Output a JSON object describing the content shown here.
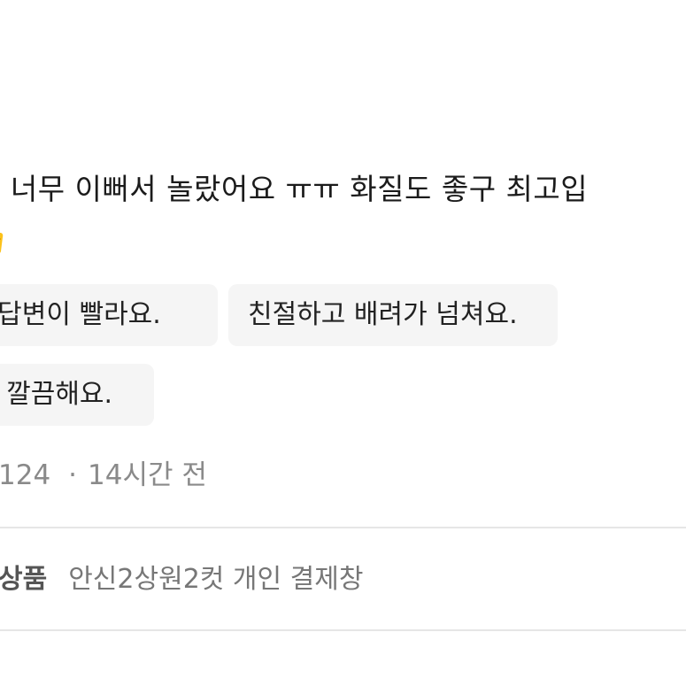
{
  "review": {
    "line1": "짜 너무 이뻐서 놀랐어요 ㅠㅠ 화질도 좋구 최고입",
    "line2_emoji": "thumbs-up-emoji"
  },
  "tags": [
    {
      "label": "톡 답변이 빨라요."
    },
    {
      "label": "친절하고 배려가 넘쳐요."
    },
    {
      "label": "이 깔끔해요."
    }
  ],
  "meta": {
    "count": "124",
    "separator": "·",
    "time": "14시간 전"
  },
  "product": {
    "label": "상품",
    "name": "안신2상원2컷 개인 결제창"
  },
  "colors": {
    "chip_bg": "#f5f5f5",
    "meta_text": "#8a8a8a",
    "divider": "#e6e6e6"
  }
}
